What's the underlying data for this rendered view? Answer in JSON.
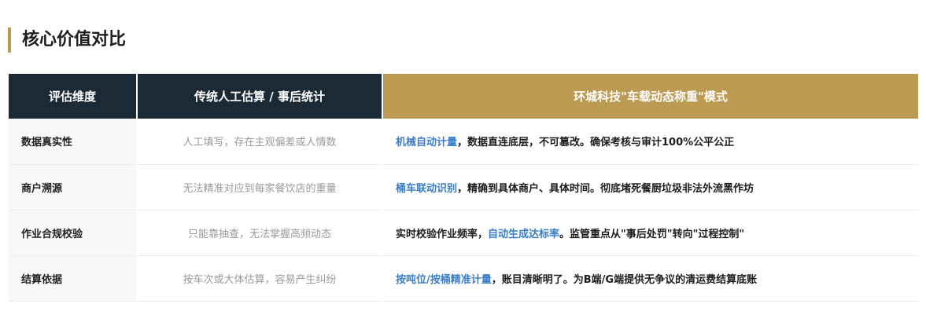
{
  "section": {
    "title": "核心价值对比"
  },
  "table": {
    "headers": [
      "评估维度",
      "传统人工估算 / 事后统计",
      "环城科技\"车载动态称重\"模式"
    ],
    "rows": [
      {
        "dimension": "数据真实性",
        "traditional": "人工填写，存在主观偏差或人情数",
        "model_pre": "",
        "model_highlight": "机械自动计量",
        "model_post": "，数据直连底层，不可篡改。确保考核与审计100%公平公正"
      },
      {
        "dimension": "商户溯源",
        "traditional": "无法精准对应到每家餐饮店的重量",
        "model_pre": "",
        "model_highlight": "桶车联动识别",
        "model_post": "，精确到具体商户、具体时间。彻底堵死餐厨垃圾非法外流黑作坊"
      },
      {
        "dimension": "作业合规校验",
        "traditional": "只能靠抽查，无法掌握高频动态",
        "model_pre": "实时校验作业频率，",
        "model_highlight": "自动生成达标率",
        "model_post": "。监管重点从\"事后处罚\"转向\"过程控制\""
      },
      {
        "dimension": "结算依据",
        "traditional": "按车次或大体估算，容易产生纠纷",
        "model_pre": "",
        "model_highlight": "按吨位/按桶精准计量",
        "model_post": "，账目清晰明了。为B端/G端提供无争议的清运费结算底账"
      }
    ]
  },
  "colors": {
    "accent_gold": "#bc9a52",
    "header_dark": "#1b2a35",
    "highlight_blue": "#3a7dc9"
  }
}
